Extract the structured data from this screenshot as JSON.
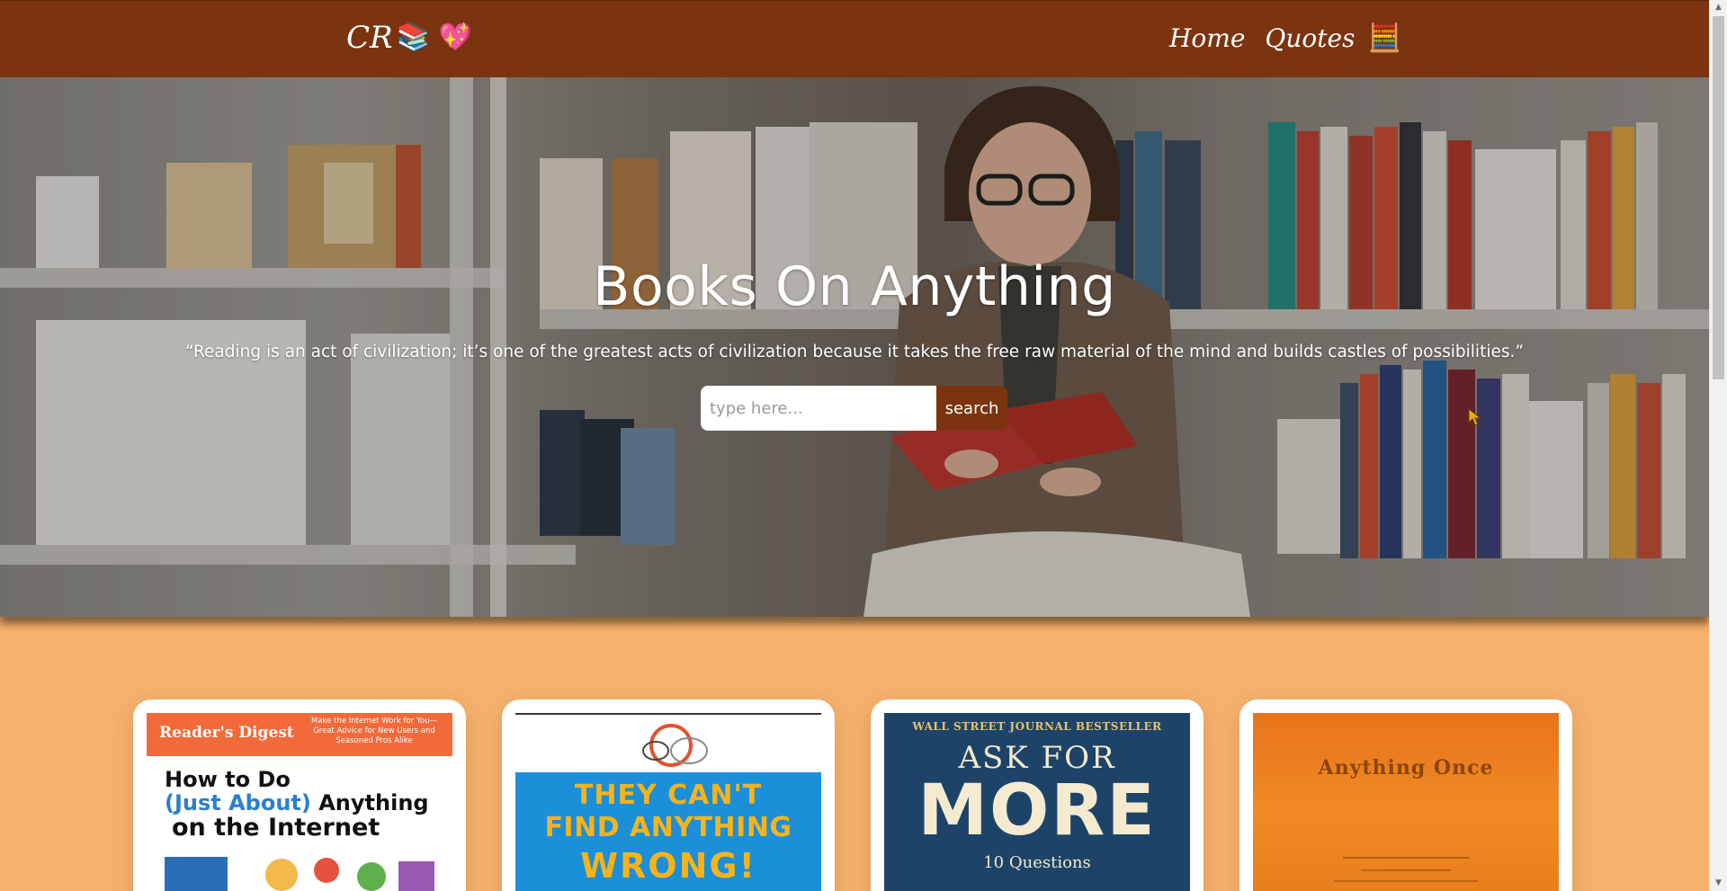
{
  "nav": {
    "brand_text": "CR",
    "brand_emojis": "📚 💖",
    "links": [
      {
        "label": "Home"
      },
      {
        "label": "Quotes"
      }
    ],
    "quotes_emoji": "🧮"
  },
  "hero": {
    "title": "Books On Anything",
    "quote": "“Reading is an act of civilization; it’s one of the greatest acts of civilization because it takes the free raw material of the mind and builds castles of possibilities.”",
    "search_placeholder": "type here...",
    "search_button": "search"
  },
  "cards": [
    {
      "cover_brand": "Reader's Digest",
      "cover_tag": "Make the Internet Work for You—Great Advice for New Users and Seasoned Pros Alike",
      "cover_title_line1": "How to Do",
      "cover_title_line2_highlight": "(Just About)",
      "cover_title_line2_rest": " Anything",
      "cover_title_line3": "on the Internet"
    },
    {
      "cover_line1": "THEY CAN'T",
      "cover_line2": "FIND ANYTHING",
      "cover_line3": "WRONG!"
    },
    {
      "cover_sub": "WALL STREET JOURNAL BESTSELLER",
      "cover_line1": "ASK FOR",
      "cover_line2": "MORE",
      "cover_line3": "10 Questions"
    },
    {
      "cover_title": "Anything Once"
    }
  ],
  "colors": {
    "nav_bg": "#7b340f",
    "page_bg": "#f4b06c",
    "search_button_bg": "#7b340f",
    "card_bg": "#ffffff"
  },
  "icons": {
    "scroll_up": "▲",
    "scroll_down": "▼"
  }
}
